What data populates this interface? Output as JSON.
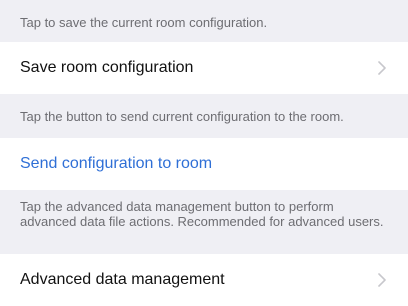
{
  "notes": {
    "save": "Tap to save the current room configuration.",
    "send": "Tap the button to send current configuration to the room.",
    "advanced": "Tap the advanced data management button to perform advanced data file actions. Recommended for advanced users."
  },
  "rows": {
    "save": {
      "label": "Save room configuration",
      "icon": "chevron-right-icon"
    },
    "send": {
      "label": "Send configuration to room"
    },
    "advanced": {
      "label": "Advanced data management",
      "icon": "chevron-right-icon"
    }
  },
  "colors": {
    "background": "#efeff4",
    "row_background": "#ffffff",
    "link": "#2f6fd6",
    "note_text": "#6d6d72",
    "chevron": "#c7c7cc"
  }
}
